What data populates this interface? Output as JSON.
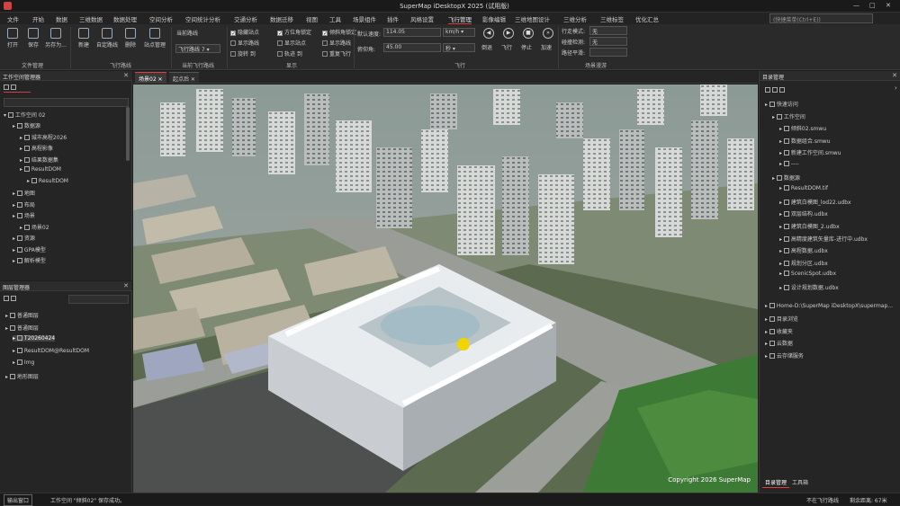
{
  "window": {
    "title": "SuperMap iDesktopX 2025 (试用版)",
    "controls": [
      "—",
      "□",
      "✕"
    ]
  },
  "menu": {
    "items": [
      "文件",
      "开始",
      "数据",
      "三维数据",
      "数据处理",
      "空间分析",
      "空间统计分析",
      "交通分析",
      "数据迁移",
      "视图",
      "工具",
      "场景组件",
      "插件",
      "风格设置",
      "飞行管理",
      "影像编辑",
      "三维地图设计",
      "三维分析",
      "三维标签",
      "优化汇总"
    ],
    "active_index": 14,
    "search_placeholder": "(快捷菜单(Ctrl+E))"
  },
  "ribbon": {
    "file_group": {
      "label": "文件管理",
      "buttons": [
        "打开",
        "保存",
        "另存为..."
      ]
    },
    "flight_path_group": {
      "label": "飞行路线",
      "buttons": [
        "新建",
        "自定路线",
        "删除",
        "站点管理"
      ]
    },
    "current_flight_group": {
      "label": "当前飞行路线",
      "current_label": "当前路线",
      "current_value": "飞行路线 7"
    },
    "display_group": {
      "label": "显示",
      "checks": [
        {
          "label": "隐藏站点",
          "on": true
        },
        {
          "label": "显示路线",
          "on": false
        },
        {
          "label": "旋转 到",
          "on": false
        },
        {
          "label": "方位角锁定",
          "on": true
        },
        {
          "label": "显示站点",
          "on": false
        },
        {
          "label": "轨迹 到",
          "on": false
        },
        {
          "label": "倾斜角锁定",
          "on": true
        },
        {
          "label": "显示路线",
          "on": false
        },
        {
          "label": "重复飞行",
          "on": false
        }
      ]
    },
    "flight_group": {
      "label": "飞行",
      "speed_label": "默认速度:",
      "speed_value": "114.05",
      "speed_unit": "km/h",
      "tilt_label": "俯仰角:",
      "tilt_value": "45.00",
      "tilt_unit": "秒",
      "controls": [
        "倒退",
        "飞行",
        "停止",
        "加速"
      ]
    },
    "scene_group": {
      "label": "场景漫游",
      "rows": [
        {
          "label": "行走模式:",
          "value": "无"
        },
        {
          "label": "碰撞检测:",
          "value": "无"
        },
        {
          "label": "路径平滑:",
          "value": ""
        }
      ]
    }
  },
  "workspace_panel": {
    "title": "工作空间管理器",
    "root": "工作空间 02",
    "items": [
      {
        "label": "数据源",
        "level": 1
      },
      {
        "label": "城市高程2026",
        "level": 2
      },
      {
        "label": "高程影像",
        "level": 2
      },
      {
        "label": "结果数据集",
        "level": 2
      },
      {
        "label": "ResultDOM",
        "level": 2
      },
      {
        "label": "ResultDOM",
        "level": 3
      },
      {
        "label": "地图",
        "level": 1
      },
      {
        "label": "布局",
        "level": 1
      },
      {
        "label": "场景",
        "level": 1
      },
      {
        "label": "场景02",
        "level": 2
      },
      {
        "label": "资源",
        "level": 1
      },
      {
        "label": "GPA模型",
        "level": 1
      },
      {
        "label": "解析模型",
        "level": 1
      }
    ]
  },
  "layer_panel": {
    "title": "图层管理器",
    "items": [
      {
        "label": "普通图层",
        "level": 0
      },
      {
        "label": "普通图层",
        "level": 0
      },
      {
        "label": "T20260424",
        "level": 1,
        "highlighted": true
      },
      {
        "label": "ResultDOM@ResultDOM",
        "level": 1
      },
      {
        "label": "Img",
        "level": 1
      },
      {
        "label": "地形图层",
        "level": 0
      }
    ]
  },
  "viewport": {
    "tabs": [
      {
        "label": "场景02",
        "active": true
      },
      {
        "label": "起点后",
        "active": false
      }
    ],
    "copyright": "Copyright 2026 SuperMap"
  },
  "catalog_panel": {
    "title": "目录管理",
    "items": [
      {
        "label": "快速访问",
        "level": 0
      },
      {
        "label": "工作空间",
        "level": 1
      },
      {
        "label": "倾斜02.smwu",
        "level": 2
      },
      {
        "label": "数据组合.smwu",
        "level": 2
      },
      {
        "label": "新建工作空间.smwu",
        "level": 2
      },
      {
        "label": "----",
        "level": 2
      },
      {
        "label": "数据源",
        "level": 1
      },
      {
        "label": "ResultDOM.tif",
        "level": 2
      },
      {
        "label": "建筑白模图_lod22.udbx",
        "level": 2
      },
      {
        "label": "双层结构.udbx",
        "level": 2
      },
      {
        "label": "建筑白模图_2.udbx",
        "level": 2
      },
      {
        "label": "高精度建筑矢量库-进行中.udbx",
        "level": 2
      },
      {
        "label": "高程数据.udbx",
        "level": 2
      },
      {
        "label": "规划分区.udbx",
        "level": 2
      },
      {
        "label": "ScenicSpot.udbx",
        "level": 2
      },
      {
        "label": "设计规划数据.udbx",
        "level": 2
      },
      {
        "label": "Home-D:\\SuperMap iDesktopX\\supermap...",
        "level": 0
      },
      {
        "label": "目录浏览",
        "level": 0
      },
      {
        "label": "收藏夹",
        "level": 0
      },
      {
        "label": "云数据",
        "level": 0
      },
      {
        "label": "云存储服务",
        "level": 0
      }
    ],
    "bottom_tabs": [
      {
        "label": "目录管理",
        "active": true
      },
      {
        "label": "工具箱",
        "active": false
      }
    ]
  },
  "status_bar": {
    "left_button": "输出窗口",
    "message": "工作空间 \"倾斜02\" 保存成功。",
    "right_a": "不在飞行路线",
    "right_b": "剩余距离: 67米"
  },
  "colors": {
    "accent": "#d04040",
    "panel_bg": "#252525",
    "ribbon_bg": "#2a2a2a"
  }
}
